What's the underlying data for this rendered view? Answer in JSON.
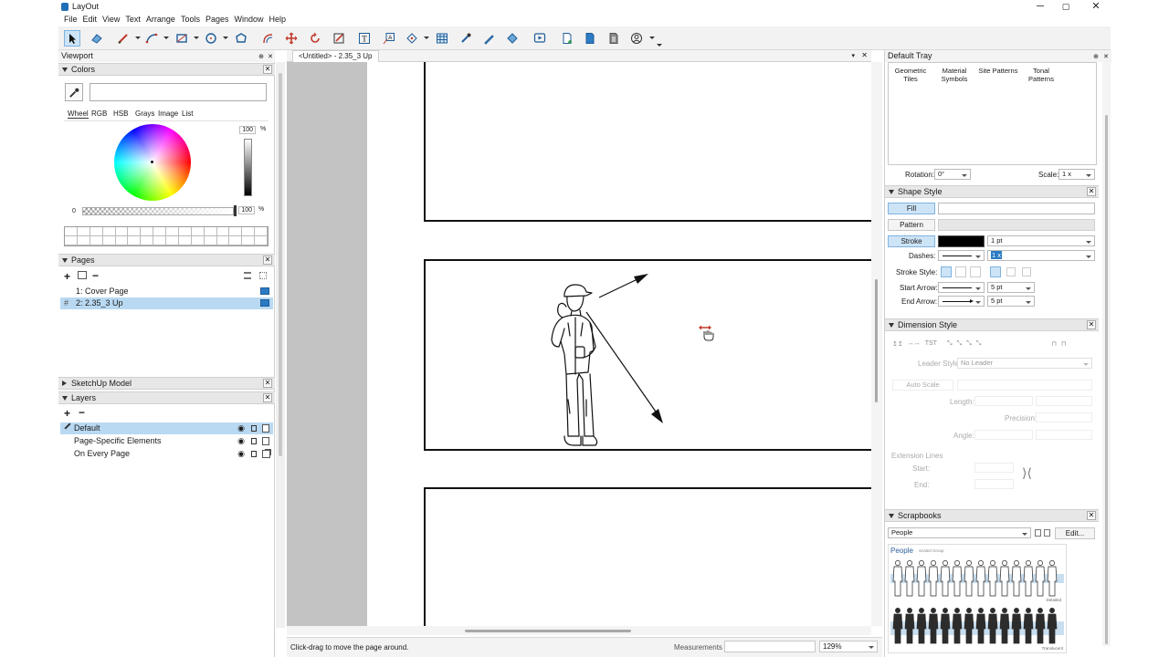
{
  "window": {
    "title": "LayOut",
    "minimize": "─",
    "maximize": "▢",
    "close": "✕"
  },
  "menu": [
    "File",
    "Edit",
    "View",
    "Text",
    "Arrange",
    "Tools",
    "Pages",
    "Window",
    "Help"
  ],
  "left_dock": {
    "title": "Viewport",
    "colors": {
      "title": "Colors",
      "tabs": [
        "Wheel",
        "RGB",
        "HSB",
        "Grays",
        "Image",
        "List"
      ],
      "brightness": "100",
      "opacity": "100",
      "percent": "%",
      "opacity_min": "0"
    },
    "pages": {
      "title": "Pages",
      "items": [
        {
          "label": "1:  Cover Page"
        },
        {
          "label": "2:  2.35_3 Up",
          "prefix": "#"
        }
      ]
    },
    "sketchup_model": {
      "title": "SketchUp Model"
    },
    "layers": {
      "title": "Layers",
      "items": [
        {
          "label": "Default"
        },
        {
          "label": "Page-Specific Elements"
        },
        {
          "label": "On Every Page"
        }
      ]
    }
  },
  "document": {
    "tab_label": "<Untitled> - 2.35_3 Up"
  },
  "status": {
    "message": "Click-drag to move the page around.",
    "measurements_label": "Measurements",
    "zoom": "129%"
  },
  "right_dock": {
    "title": "Default Tray",
    "pattern_categories": [
      "Geometric Tiles",
      "Material Symbols",
      "Site Patterns",
      "Tonal Patterns"
    ],
    "rotation_label": "Rotation:",
    "rotation_value": "0°",
    "scale_label": "Scale:",
    "scale_value": "1 x",
    "shape_style": {
      "title": "Shape Style",
      "fill": "Fill",
      "pattern": "Pattern",
      "stroke": "Stroke",
      "stroke_width": "1 pt",
      "dashes_label": "Dashes:",
      "dash_scale": "1 x",
      "stroke_style_label": "Stroke Style:",
      "start_arrow_label": "Start Arrow:",
      "start_arrow_size": "5 pt",
      "end_arrow_label": "End Arrow:",
      "end_arrow_size": "5 pt",
      "stroke_color": "#000000"
    },
    "dimension_style": {
      "title": "Dimension Style",
      "leader_style_label": "Leader Style",
      "leader_style_value": "No Leader",
      "auto_scale": "Auto Scale",
      "length_label": "Length:",
      "precision_label": "Precision:",
      "angle_label": "Angle:",
      "extension_lines_label": "Extension Lines",
      "start_label": "Start:",
      "end_label": "End:"
    },
    "scrapbooks": {
      "title": "Scrapbooks",
      "selected": "People",
      "edit": "Edit...",
      "preview_title": "People",
      "preview_subtitle": "Scaled Group",
      "detailed": "Detailed",
      "translucent": "Translucent"
    }
  },
  "colors": {
    "accent": "#cde4f7",
    "selection": "#b9d9f2",
    "canvas_bg": "#c3c3c3"
  }
}
